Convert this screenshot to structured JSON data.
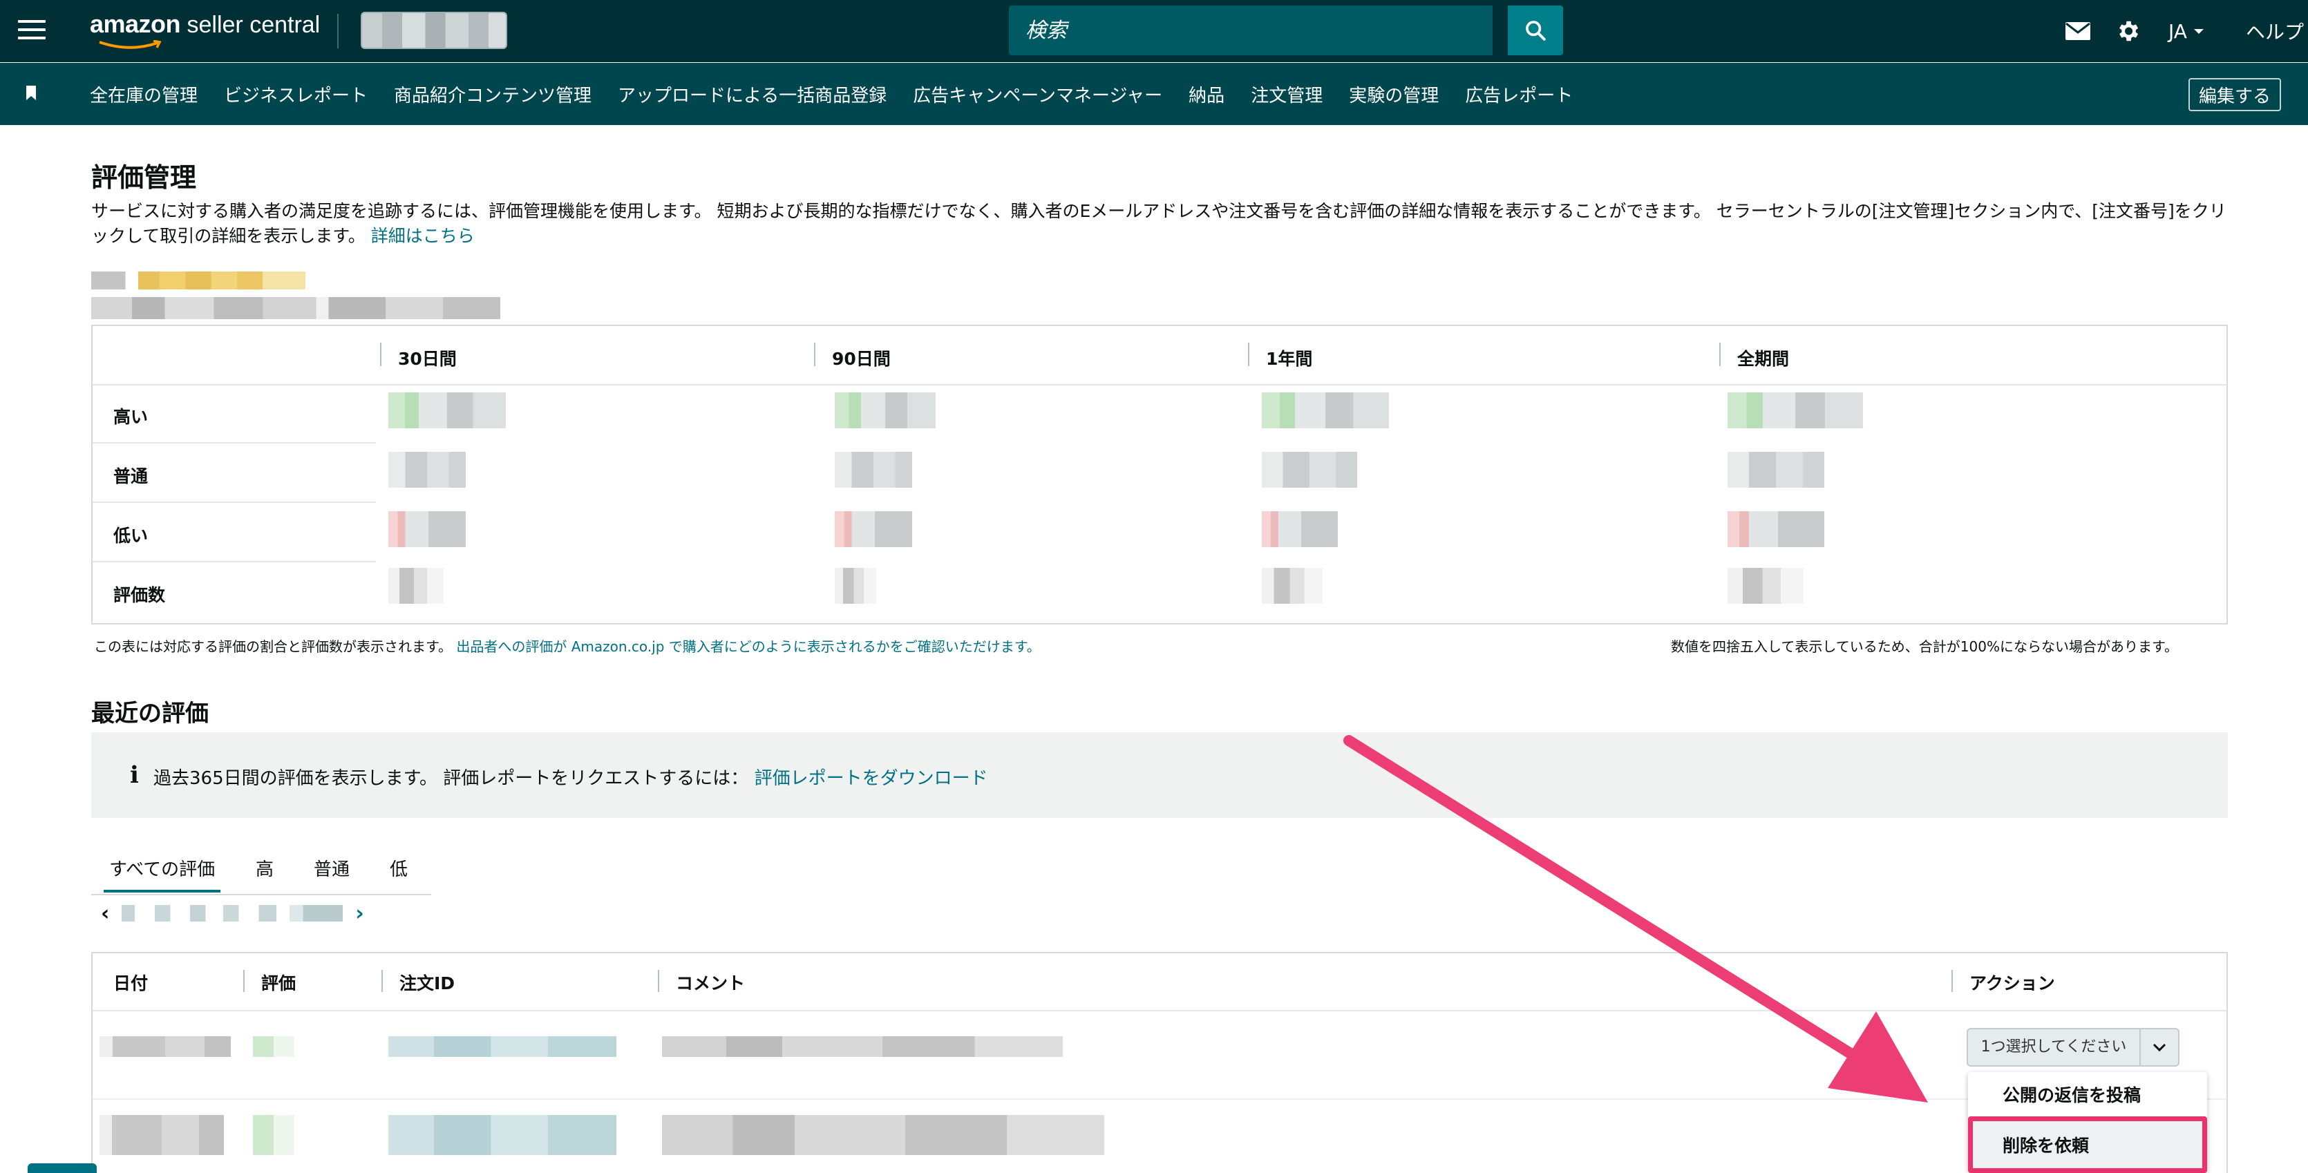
{
  "topbar": {
    "logo_word": "amazon",
    "logo_rest": " seller central",
    "search_placeholder": "検索",
    "lang": "JA",
    "help": "ヘルプ"
  },
  "nav": {
    "items": [
      "全在庫の管理",
      "ビジネスレポート",
      "商品紹介コンテンツ管理",
      "アップロードによる一括商品登録",
      "広告キャンペーンマネージャー",
      "納品",
      "注文管理",
      "実験の管理",
      "広告レポート"
    ],
    "edit": "編集する"
  },
  "page": {
    "title": "評価管理",
    "description": "サービスに対する購入者の満足度を追跡するには、評価管理機能を使用します。 短期および長期的な指標だけでなく、購入者のEメールアドレスや注文番号を含む評価の詳細な情報を表示することができます。 セラーセントラルの[注文管理]セクション内で、[注文番号]をクリックして取引の詳細を表示します。",
    "description_link": "詳細はこちら"
  },
  "summary": {
    "columns": [
      "30日間",
      "90日間",
      "1年間",
      "全期間"
    ],
    "rows": [
      "高い",
      "普通",
      "低い",
      "評価数"
    ],
    "note_left": "この表には対応する評価の割合と評価数が表示されます。",
    "note_left_link": "出品者への評価が Amazon.co.jp で購入者にどのように表示されるかをご確認いただけます。",
    "note_right": "数値を四捨五入して表示しているため、合計が100%にならない場合があります。"
  },
  "recent": {
    "title": "最近の評価",
    "info_text": "過去365日間の評価を表示します。 評価レポートをリクエストするには：",
    "info_link": "評価レポートをダウンロード",
    "tabs": [
      "すべての評価",
      "高",
      "普通",
      "低"
    ],
    "columns": [
      "日付",
      "評価",
      "注文ID",
      "コメント",
      "アクション"
    ],
    "action_select": "1つ選択してください",
    "action_options": [
      "公開の返信を投稿",
      "削除を依頼"
    ]
  },
  "colors": {
    "topbar": "#002f36",
    "navbar": "#00464f",
    "link": "#007185",
    "highlight": "#e8336c"
  }
}
